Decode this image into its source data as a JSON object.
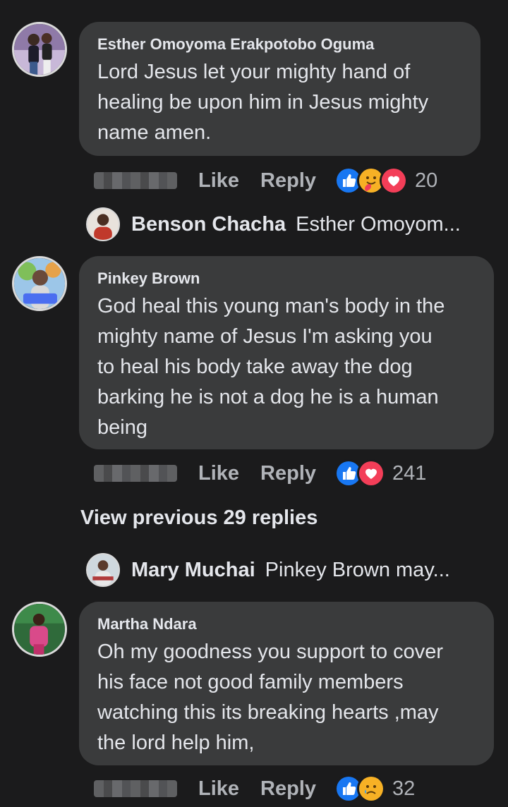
{
  "comments": [
    {
      "author": "Esther Omoyoma Erakpotobo Oguma",
      "lines": [
        "Lord Jesus let your mighty hand of",
        "healing be upon him in Jesus mighty",
        "name amen."
      ],
      "like_label": "Like",
      "reply_label": "Reply",
      "reactions": [
        "like-icon",
        "care-icon",
        "love-icon"
      ],
      "reaction_count": "20",
      "reply_preview": {
        "name": "Benson Chacha",
        "text": "Esther Omoyom..."
      }
    },
    {
      "author": "Pinkey Brown",
      "lines": [
        "God heal this young man's body in the",
        "mighty name of Jesus I'm asking you",
        "to heal his body take away the dog",
        "barking he is not a dog he is a human",
        "being"
      ],
      "like_label": "Like",
      "reply_label": "Reply",
      "reactions": [
        "like-icon",
        "love-icon"
      ],
      "reaction_count": "241",
      "view_previous": "View previous 29 replies",
      "reply_preview": {
        "name": "Mary Muchai",
        "text": "Pinkey Brown may..."
      }
    },
    {
      "author": "Martha Ndara",
      "lines": [
        "Oh my goodness you support to cover",
        "his face not good family members",
        "watching this its breaking hearts ,may",
        "the lord help him,"
      ],
      "like_label": "Like",
      "reply_label": "Reply",
      "reactions": [
        "like-icon",
        "sad-icon"
      ],
      "reaction_count": "32"
    }
  ],
  "colors": {
    "background": "#1b1b1c",
    "bubble": "#3a3b3c",
    "text": "#e4e6eb",
    "secondary": "#b0b3b8",
    "like_blue": "#1877f2",
    "love_red": "#f33e58",
    "care_yellow": "#f7b125"
  }
}
